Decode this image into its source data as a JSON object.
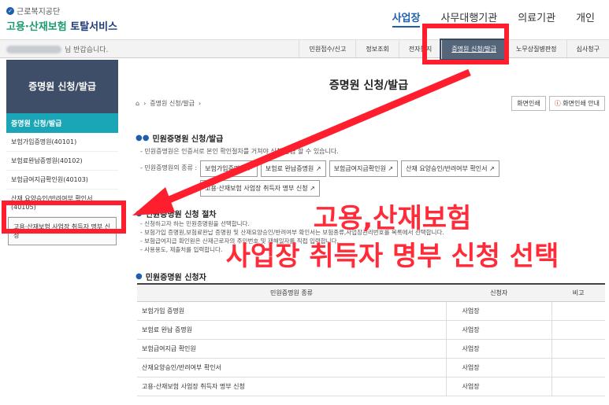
{
  "header": {
    "org": "근로복지공단",
    "service_green": "고용·산재보험",
    "service_rest": " 토탈서비스",
    "nav": [
      "사업장",
      "사무대행기관",
      "의료기관",
      "개인"
    ],
    "nav_active": "사업장"
  },
  "greeting": "님 반갑습니다.",
  "subnav": [
    "민원접수/신고",
    "정보조회",
    "전자통지",
    "증명원 신청/발급",
    "노무상질병판정",
    "심사청구"
  ],
  "sidebar": {
    "title": "증명원 신청/발급",
    "active": "증명원 신청/발급",
    "items": [
      "보험가입증명원(40101)",
      "보험료완납증명원(40102)",
      "보험급여지급확인원(40103)",
      "산재 요양승인/반려여부 확인서 (40105)",
      "고용·산재보험 사업장 취득자 명부 신청"
    ]
  },
  "page_title": "증명원 신청/발급",
  "breadcrumb": "증명원 신청/발급",
  "buttons": {
    "print": "화면인쇄",
    "print_guide": "화면인쇄 안내"
  },
  "sec1": {
    "title": "민원증명원 신청/발급",
    "desc": "- 민원증명원은 인증서로 본인 확인절차를 거쳐야 신청/발급 할 수 있습니다.",
    "kinds_label": "- 민원증명원의 종류 :",
    "docs": [
      "보험가입증명원",
      "보험료 완납증명원",
      "보험급여지급확인원",
      "산재 요양승인/반려여부 확인서",
      "고용·산재보험 사업장 취득자 명부 신청"
    ]
  },
  "sec2": {
    "title": "민원증명원 신청 절차",
    "lines": [
      "- 신청하고자 하는 민원증명원을 선택합니다.",
      "- 보험가입 증명원,보험료완납 증명원 및 산재요양승인/반려여부 확인서는 보험종류,사업장관리번호를 목록에서 선택합니다.",
      "- 보험급여지급 확인원은 산재근로자의 주민번호 및 재해일자를 직접 입력합니다.",
      "- 사용용도, 제출처를 입력합니다."
    ]
  },
  "sec3": {
    "title": "민원증명원 신청자"
  },
  "table": {
    "headers": [
      "민원증명원 종류",
      "신청자",
      "비고"
    ],
    "rows": [
      [
        "보험가입 증명원",
        "사업장",
        ""
      ],
      [
        "보험료 완납 증명원",
        "사업장",
        ""
      ],
      [
        "보험급여지급 확인원",
        "사업장",
        ""
      ],
      [
        "산재요양승인/반려여부 확인서",
        "사업장",
        ""
      ],
      [
        "고용-산재보험 사업장 취득자 명부 신청",
        "사업장",
        ""
      ]
    ]
  },
  "annotation": {
    "line1": "고용,산재보험",
    "line2": "사업장 취득자 명부 신청 선택"
  },
  "colors": {
    "accent": "#1aa6b7",
    "highlight": "#ff1e2e",
    "sidebar_head": "#3f4e68"
  }
}
